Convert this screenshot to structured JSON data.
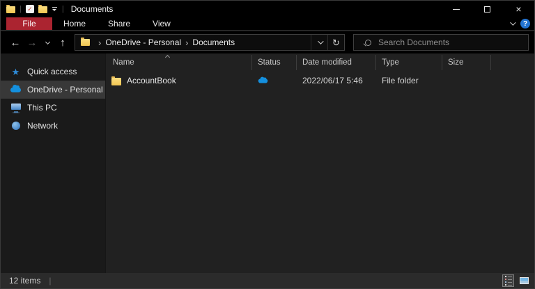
{
  "titlebar": {
    "title": "Documents",
    "controls": {
      "minimize": "minimize",
      "maximize": "maximize",
      "close_glyph": "×"
    }
  },
  "icons": {
    "back": "←",
    "forward": "→",
    "up": "↑",
    "refresh": "↻",
    "breadcrumb": "›",
    "separator": "|",
    "star": "★",
    "check": "✓",
    "help": "?"
  },
  "ribbon": {
    "tabs": [
      {
        "label": "File",
        "accent": true
      },
      {
        "label": "Home",
        "accent": false
      },
      {
        "label": "Share",
        "accent": false
      },
      {
        "label": "View",
        "accent": false
      }
    ],
    "accent_color": "#ab2430"
  },
  "navbar": {
    "crumbs": [
      "OneDrive - Personal",
      "Documents"
    ],
    "search_placeholder": "Search Documents"
  },
  "sidebar": {
    "items": [
      {
        "label": "Quick access",
        "icon": "star-icon",
        "selected": false
      },
      {
        "label": "OneDrive - Personal",
        "icon": "onedrive-cloud-icon",
        "selected": true
      },
      {
        "label": "This PC",
        "icon": "monitor-icon",
        "selected": false
      },
      {
        "label": "Network",
        "icon": "network-icon",
        "selected": false
      }
    ]
  },
  "filelist": {
    "columns": [
      {
        "label": "Name",
        "sorted": "asc"
      },
      {
        "label": "Status",
        "sorted": null
      },
      {
        "label": "Date modified",
        "sorted": null
      },
      {
        "label": "Type",
        "sorted": null
      },
      {
        "label": "Size",
        "sorted": null
      }
    ],
    "rows": [
      {
        "name": "AccountBook",
        "status_icon": "onedrive-cloud-icon",
        "date_modified": "2022/06/17 5:46",
        "type": "File folder",
        "size": ""
      }
    ]
  },
  "statusbar": {
    "items_count": "12 items"
  },
  "colors": {
    "accent_red": "#ab2430",
    "onedrive_blue": "#1490df",
    "folder_yellow": "#f2c652",
    "window_bg": "#000000",
    "content_bg": "#212121",
    "sidebar_bg": "#1a1a1a",
    "statusbar_bg": "#2b2b2b"
  }
}
